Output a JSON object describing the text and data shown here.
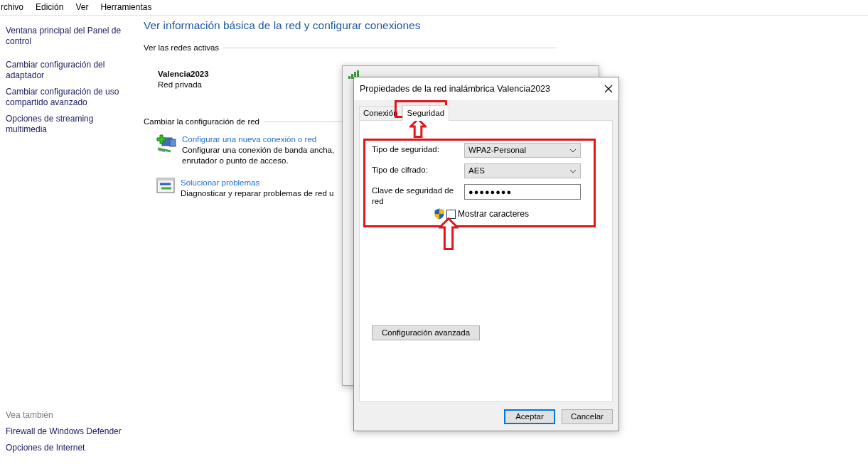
{
  "menu": [
    {
      "label": "rchivo"
    },
    {
      "label": "Edición"
    },
    {
      "label": "Ver"
    },
    {
      "label": "Herramientas"
    }
  ],
  "sidebar": {
    "links": [
      "Ventana principal del Panel de control",
      "Cambiar configuración del adaptador",
      "Cambiar configuración de uso compartido avanzado",
      "Opciones de streaming multimedia"
    ],
    "see_also_title": "Vea también",
    "see_also": [
      "Firewall de Windows Defender",
      "Opciones de Internet"
    ]
  },
  "main": {
    "title": "Ver información básica de la red y configurar conexiones",
    "active_section": "Ver las redes activas",
    "network": {
      "name": "Valencia2023",
      "type": "Red privada"
    },
    "change_section": "Cambiar la configuración de red",
    "tasks": [
      {
        "kind": "new-connection",
        "link": "Configurar una nueva conexión o red",
        "description": "Configurar una conexión de banda ancha, enrutador o punto de acceso."
      },
      {
        "kind": "troubleshoot",
        "link": "Solucionar problemas",
        "description": "Diagnosticar y reparar problemas de red u"
      }
    ]
  },
  "dialog": {
    "title": "Propiedades de la red inalámbrica Valencia2023",
    "tabs": [
      {
        "label": "Conexión",
        "selected": false
      },
      {
        "label": "Seguridad",
        "selected": true
      }
    ],
    "fields": [
      {
        "kind": "select",
        "label": "Tipo de seguridad:",
        "value": "WPA2-Personal"
      },
      {
        "kind": "select",
        "label": "Tipo de cifrado:",
        "value": "AES"
      },
      {
        "kind": "password",
        "label": "Clave de seguridad de red",
        "value": "●●●●●●●●"
      }
    ],
    "show_characters": {
      "label": "Mostrar caracteres",
      "checked": false
    },
    "advanced_button": "Configuración avanzada",
    "buttons": [
      {
        "label": "Aceptar",
        "default": true
      },
      {
        "label": "Cancelar",
        "default": false
      }
    ]
  }
}
